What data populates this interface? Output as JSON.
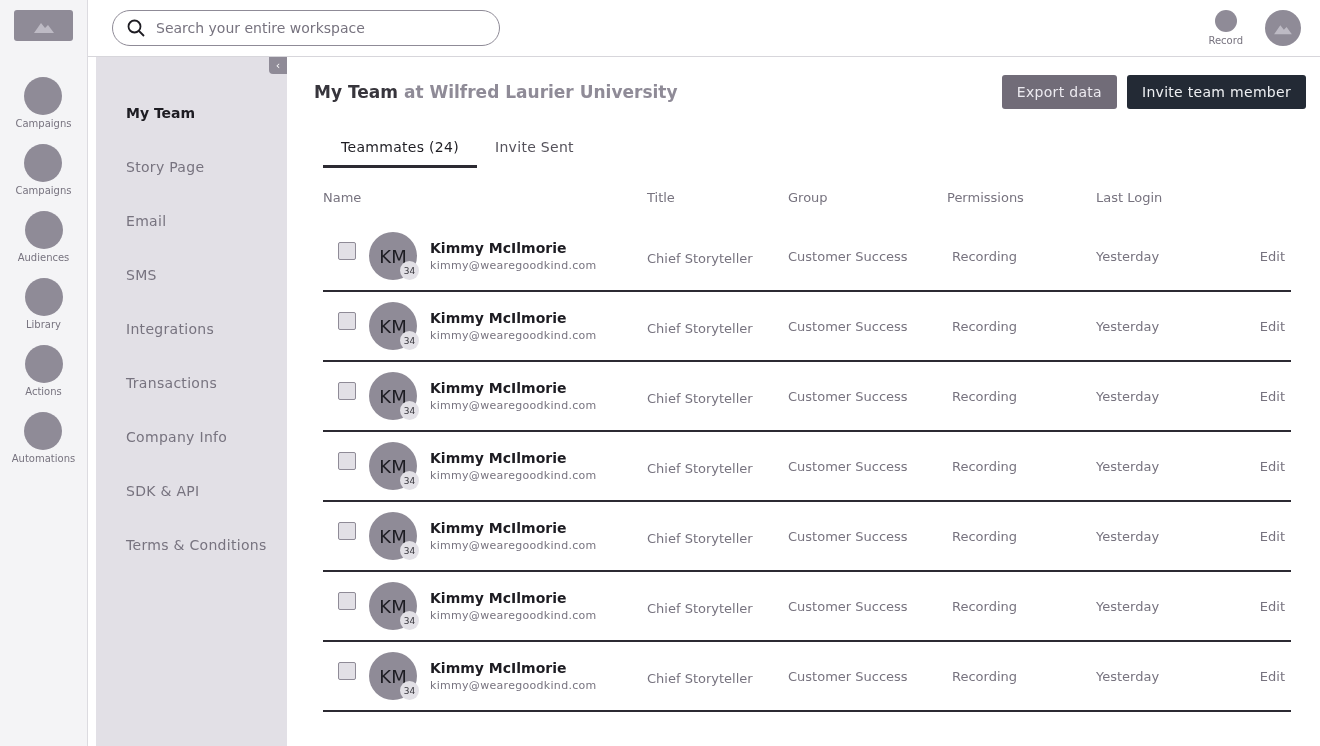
{
  "rail": {
    "items": [
      {
        "label": "Campaigns"
      },
      {
        "label": "Campaigns"
      },
      {
        "label": "Audiences"
      },
      {
        "label": "Library"
      },
      {
        "label": "Actions"
      },
      {
        "label": "Automations"
      }
    ]
  },
  "search": {
    "placeholder": "Search your entire workspace"
  },
  "topbar": {
    "record_label": "Record"
  },
  "subnav": {
    "items": [
      {
        "label": "My Team",
        "selected": true
      },
      {
        "label": "Story Page",
        "selected": false
      },
      {
        "label": "Email",
        "selected": false
      },
      {
        "label": "SMS",
        "selected": false
      },
      {
        "label": "Integrations",
        "selected": false
      },
      {
        "label": "Transactions",
        "selected": false
      },
      {
        "label": "Company Info",
        "selected": false
      },
      {
        "label": "SDK & API",
        "selected": false
      },
      {
        "label": "Terms & Conditions",
        "selected": false
      }
    ],
    "collapse_glyph": "‹"
  },
  "page": {
    "title": "My Team",
    "subtitle": "at Wilfred Laurier University",
    "buttons": [
      {
        "label": "Export data",
        "kind": "secondary"
      },
      {
        "label": "Invite team member",
        "kind": "primary"
      }
    ]
  },
  "tabs": [
    {
      "label": "Teammates (24)",
      "selected": true
    },
    {
      "label": "Invite Sent",
      "selected": false
    }
  ],
  "table": {
    "columns": [
      "Name",
      "Title",
      "Group",
      "Permissions",
      "Last Login"
    ],
    "rows": [
      {
        "checked": false,
        "initials": "KM",
        "badge": "34",
        "name": "Kimmy McIlmorie",
        "email": "kimmy@wearegoodkind.com",
        "title": "Chief Storyteller",
        "group": "Customer Success",
        "permissions": "Recording",
        "last_login": "Yesterday",
        "action": "Edit"
      },
      {
        "checked": false,
        "initials": "KM",
        "badge": "34",
        "name": "Kimmy McIlmorie",
        "email": "kimmy@wearegoodkind.com",
        "title": "Chief Storyteller",
        "group": "Customer Success",
        "permissions": "Recording",
        "last_login": "Yesterday",
        "action": "Edit"
      },
      {
        "checked": false,
        "initials": "KM",
        "badge": "34",
        "name": "Kimmy McIlmorie",
        "email": "kimmy@wearegoodkind.com",
        "title": "Chief Storyteller",
        "group": "Customer Success",
        "permissions": "Recording",
        "last_login": "Yesterday",
        "action": "Edit"
      },
      {
        "checked": false,
        "initials": "KM",
        "badge": "34",
        "name": "Kimmy McIlmorie",
        "email": "kimmy@wearegoodkind.com",
        "title": "Chief Storyteller",
        "group": "Customer Success",
        "permissions": "Recording",
        "last_login": "Yesterday",
        "action": "Edit"
      },
      {
        "checked": false,
        "initials": "KM",
        "badge": "34",
        "name": "Kimmy McIlmorie",
        "email": "kimmy@wearegoodkind.com",
        "title": "Chief Storyteller",
        "group": "Customer Success",
        "permissions": "Recording",
        "last_login": "Yesterday",
        "action": "Edit"
      },
      {
        "checked": false,
        "initials": "KM",
        "badge": "34",
        "name": "Kimmy McIlmorie",
        "email": "kimmy@wearegoodkind.com",
        "title": "Chief Storyteller",
        "group": "Customer Success",
        "permissions": "Recording",
        "last_login": "Yesterday",
        "action": "Edit"
      },
      {
        "checked": false,
        "initials": "KM",
        "badge": "34",
        "name": "Kimmy McIlmorie",
        "email": "kimmy@wearegoodkind.com",
        "title": "Chief Storyteller",
        "group": "Customer Success",
        "permissions": "Recording",
        "last_login": "Yesterday",
        "action": "Edit"
      }
    ]
  }
}
